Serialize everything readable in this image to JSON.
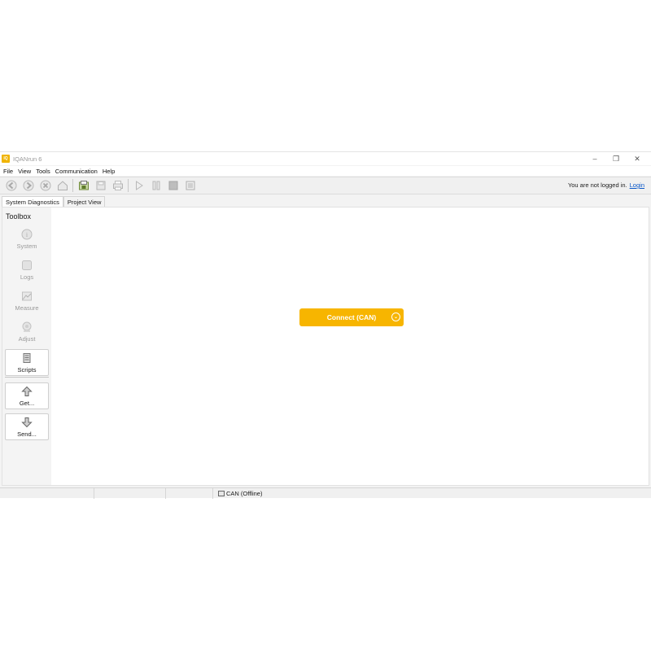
{
  "window": {
    "icon_text": "IQ",
    "title": "IQANrun 6",
    "controls": {
      "minimize": "–",
      "maximize": "❐",
      "close": "✕"
    }
  },
  "menu": [
    "File",
    "View",
    "Tools",
    "Communication",
    "Help"
  ],
  "toolbar": {
    "buttons": [
      "back-icon",
      "forward-icon",
      "stop-icon",
      "home-icon",
      "open-project-icon",
      "save-icon",
      "print-icon",
      "play-icon",
      "pause-icon",
      "record-icon",
      "snapshot-icon"
    ],
    "login_status": "You are not logged in.",
    "login_link": "Login"
  },
  "tabs": [
    {
      "label": "System Diagnostics",
      "active": true
    },
    {
      "label": "Project View",
      "active": false
    }
  ],
  "toolbox": {
    "title": "Toolbox",
    "items": [
      {
        "label": "System",
        "enabled": false,
        "icon": "info-icon"
      },
      {
        "label": "Logs",
        "enabled": false,
        "icon": "logs-icon"
      },
      {
        "label": "Measure",
        "enabled": false,
        "icon": "measure-icon"
      },
      {
        "label": "Adjust",
        "enabled": false,
        "icon": "adjust-icon"
      },
      {
        "label": "Scripts",
        "enabled": true,
        "icon": "scripts-icon"
      },
      {
        "label": "Get...",
        "enabled": true,
        "icon": "upload-icon"
      },
      {
        "label": "Send...",
        "enabled": true,
        "icon": "download-icon"
      }
    ]
  },
  "main": {
    "connect_label": "Connect (CAN)",
    "connect_color": "#f7b500"
  },
  "statusbar": {
    "connection": "CAN (Offline)"
  }
}
